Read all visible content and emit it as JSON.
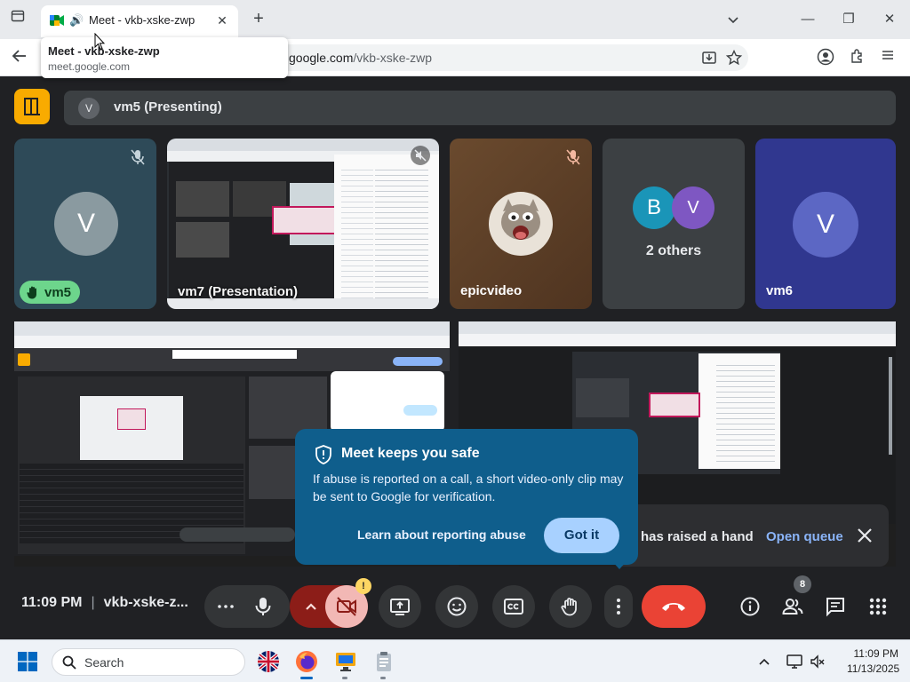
{
  "browser": {
    "tab": {
      "title": "Meet - vkb-xske-zwp",
      "close_label": "✕"
    },
    "tooltip": {
      "title": "Meet - vkb-xske-zwp",
      "url": "meet.google.com"
    },
    "address": {
      "host": "google.com",
      "path": "/vkb-xske-zwp"
    },
    "new_tab_label": "+",
    "window_controls": {
      "minimize": "—",
      "maximize": "❐",
      "close": "✕"
    }
  },
  "meet": {
    "presenting_bar": {
      "avatar_letter": "V",
      "label": "vm5 (Presenting)"
    },
    "tiles": [
      {
        "name": "vm5",
        "avatar_letter": "V",
        "hand_raised": true,
        "muted": true
      },
      {
        "name": "vm7 (Presentation)",
        "type": "presentation"
      },
      {
        "name": "epicvideo",
        "muted": true
      },
      {
        "name": "2 others",
        "avatar_letters": [
          "B",
          "V"
        ]
      },
      {
        "name": "vm6",
        "avatar_letter": "V"
      }
    ],
    "safety_popup": {
      "title": "Meet keeps you safe",
      "body": "If abuse is reported on a call, a short video-only clip may be sent to Google for verification.",
      "learn_link": "Learn about reporting abuse",
      "got_it": "Got it"
    },
    "hand_toast": {
      "message": "has raised a hand",
      "open_queue": "Open queue"
    },
    "controls": {
      "time": "11:09 PM",
      "meeting_code": "vkb-xske-z...",
      "people_count": "8",
      "camera_warning": "!"
    },
    "colors": {
      "accent_yellow": "#f9ab00",
      "end_call_red": "#ea4335",
      "hand_green": "#6dd58c",
      "popup_blue": "#0f5e8c"
    }
  },
  "taskbar": {
    "search_label": "Search",
    "time": "11:09 PM",
    "date": "11/13/2025"
  }
}
